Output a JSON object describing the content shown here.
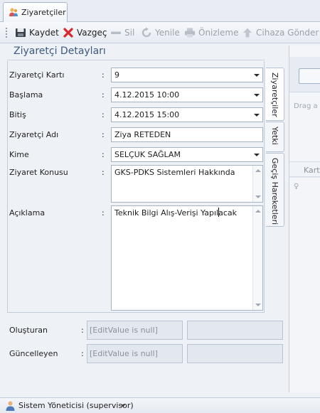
{
  "tabs": [
    {
      "label": "Ziyaretçiler",
      "icon": "visitors-icon"
    }
  ],
  "toolbar": {
    "save": {
      "label": "Kaydet",
      "icon": "save-icon",
      "enabled": true
    },
    "cancel": {
      "label": "Vazgeç",
      "icon": "cancel-icon",
      "enabled": true
    },
    "delete": {
      "label": "Sil",
      "icon": "delete-icon",
      "enabled": false
    },
    "refresh": {
      "label": "Yenile",
      "icon": "refresh-icon",
      "enabled": false
    },
    "preview": {
      "label": "Önizleme",
      "icon": "print-preview-icon",
      "enabled": false
    },
    "send": {
      "label": "Cihaza Gönder",
      "icon": "send-to-device-icon",
      "enabled": false
    }
  },
  "panel": {
    "title": "Ziyaretçi Detayları"
  },
  "form": {
    "visitor_card": {
      "label": "Ziyaretçi Kartı",
      "value": "9"
    },
    "start": {
      "label": "Başlama",
      "value": "4.12.2015 10:00"
    },
    "end": {
      "label": "Bitiş",
      "value": "4.12.2015 15:00"
    },
    "visitor_name": {
      "label": "Ziyaretçi Adı",
      "value": "Ziya RETEDEN"
    },
    "to_whom": {
      "label": "Kime",
      "value": "SELÇUK SAĞLAM"
    },
    "subject": {
      "label": "Ziyaret Konusu",
      "value": "GKS-PDKS Sistemleri Hakkında"
    },
    "description": {
      "label": "Açıklama",
      "value": "Teknik Bilgi Alış-Verişi Yapılacak"
    },
    "created_by": {
      "label": "Oluşturan",
      "value": "[EditValue is null]",
      "value2": ""
    },
    "updated_by": {
      "label": "Güncelleyen",
      "value": "[EditValue is null]",
      "value2": ""
    },
    "colon": ":"
  },
  "side_tabs": [
    {
      "label": "Ziyaretçiler",
      "active": true
    },
    {
      "label": "Yetki",
      "active": false
    },
    {
      "label": "Geçiş Hareketleri",
      "active": false
    }
  ],
  "right_panel": {
    "drag_hint": "Drag a c",
    "column_header": "Kart",
    "row_indicator": "♀"
  },
  "status_bar": {
    "user": "Sistem Yöneticisi (supervisor)"
  },
  "colors": {
    "accent": "#3d5a80",
    "cancel_red": "#d9262c",
    "disabled": "#9aa2ad"
  }
}
